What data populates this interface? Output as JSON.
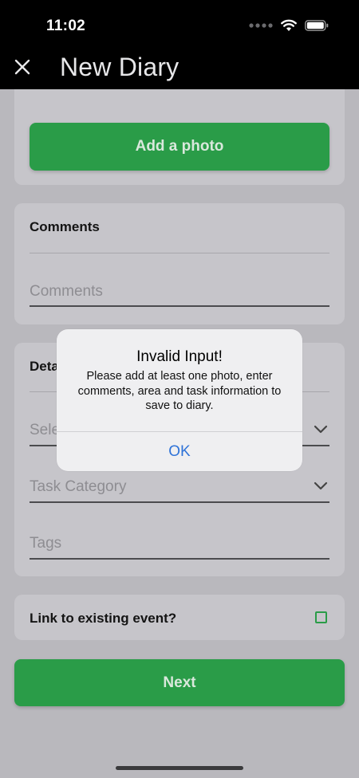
{
  "status_bar": {
    "time": "11:02"
  },
  "nav": {
    "title": "New Diary"
  },
  "photo_section": {
    "add_photo_label": "Add a photo"
  },
  "comments_section": {
    "heading": "Comments",
    "placeholder": "Comments"
  },
  "details_section": {
    "heading": "Deta",
    "select_placeholder": "Sele",
    "task_category_placeholder": "Task Category",
    "tags_placeholder": "Tags"
  },
  "link_section": {
    "label": "Link to existing event?",
    "checked": false
  },
  "footer": {
    "next_label": "Next"
  },
  "alert": {
    "title": "Invalid Input!",
    "message": "Please add at least one photo, enter comments, area and task information to save to diary.",
    "ok_label": "OK"
  },
  "colors": {
    "accent_green": "#2a9c48",
    "link_blue": "#2f73d8",
    "nav_bg": "#000000"
  }
}
